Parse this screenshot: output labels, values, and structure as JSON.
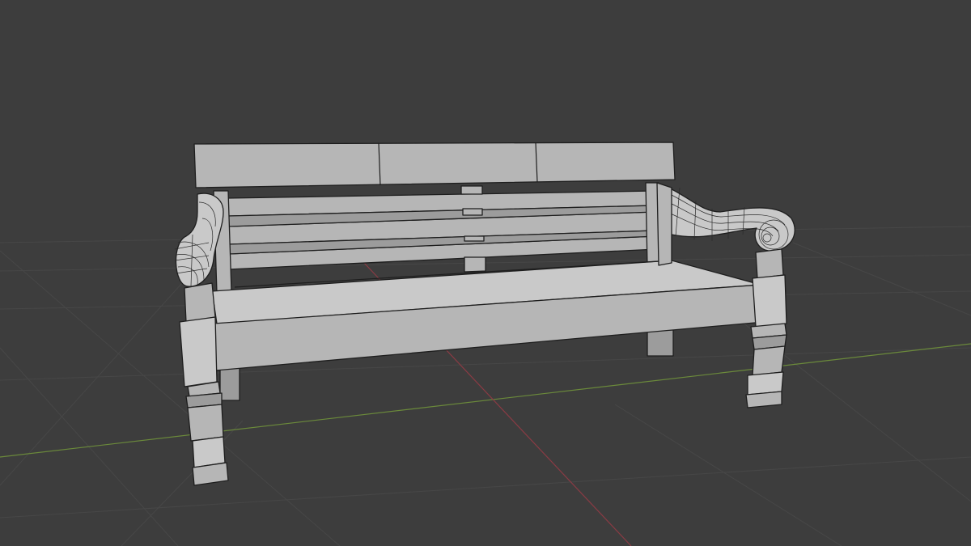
{
  "viewport": {
    "background": "#3d3d3d",
    "grid_color": "#474747",
    "x_axis_color": "#8a3b44",
    "y_axis_color": "#6b8a3b"
  },
  "object": {
    "name_icon": "bench-mesh-icon",
    "mode": "wireframe-overlay",
    "surface_color": "#b6b6b6",
    "edge_color": "#1e1e1e"
  }
}
